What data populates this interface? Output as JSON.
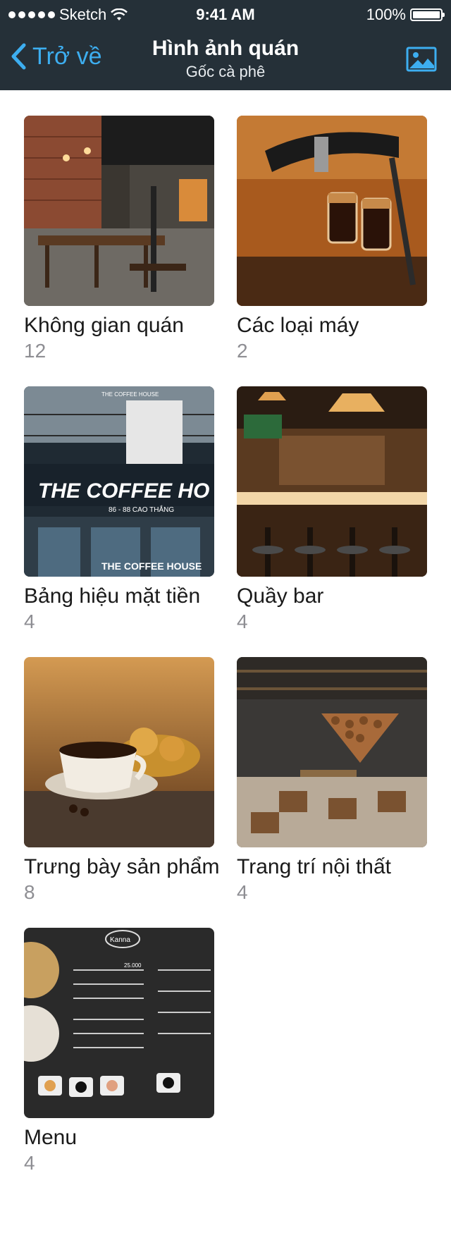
{
  "status_bar": {
    "carrier": "Sketch",
    "time": "9:41 AM",
    "battery": "100%"
  },
  "nav": {
    "back_label": "Trở về",
    "title": "Hình ảnh quán",
    "subtitle": "Gốc cà phê",
    "right_icon": "image-icon",
    "tint": "#3daef0",
    "background": "#253038"
  },
  "albums": [
    {
      "title": "Không gian quán",
      "count": "12"
    },
    {
      "title": "Các loại máy",
      "count": "2"
    },
    {
      "title": "Bảng hiệu mặt tiền",
      "count": "4"
    },
    {
      "title": "Quầy bar",
      "count": "4"
    },
    {
      "title": "Trưng bày sản phẩm",
      "count": "8"
    },
    {
      "title": "Trang trí nội thất",
      "count": "4"
    },
    {
      "title": "Menu",
      "count": "4"
    }
  ],
  "photo_texts": {
    "storefront_sign": "THE COFFEE HO",
    "storefront_address": "86 - 88 CAO THẮNG",
    "storefront_lower": "THE COFFEE HOUSE",
    "storefront_banner": "THE COFFEE HOUSE",
    "menu_logo": "Kanna",
    "menu_price": "25.000"
  }
}
